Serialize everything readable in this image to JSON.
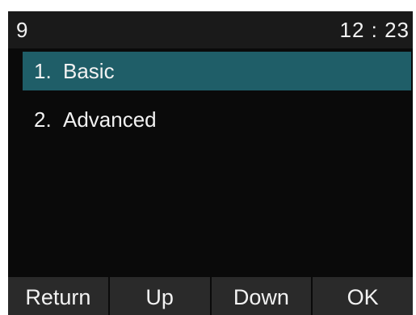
{
  "status": {
    "line_number": "9",
    "time": "12 : 23"
  },
  "menu": {
    "items": [
      {
        "number": "1.",
        "label": "Basic",
        "selected": true
      },
      {
        "number": "2.",
        "label": "Advanced",
        "selected": false
      }
    ]
  },
  "softkeys": {
    "return_label": "Return",
    "up_label": "Up",
    "down_label": "Down",
    "ok_label": "OK"
  },
  "colors": {
    "selection": "#1f5e68",
    "background": "#0a0a0a",
    "softkey_bar": "#2a2a2a"
  }
}
